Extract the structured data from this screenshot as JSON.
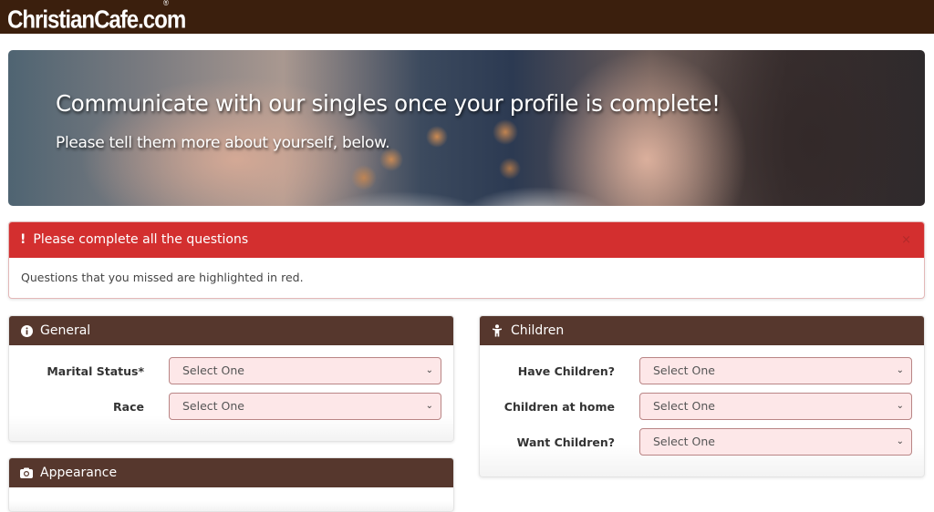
{
  "header": {
    "logo_text": "ChristianCafe.com",
    "registered_mark": "®",
    "bg_color": "#3b1f0d"
  },
  "hero": {
    "title": "Communicate with our singles once your profile is complete!",
    "subtitle": "Please tell them more about yourself, below."
  },
  "alert": {
    "icon": "exclamation-icon",
    "icon_glyph": "!",
    "title": "Please complete all the questions",
    "message": "Questions that you missed are highlighted in red.",
    "close_glyph": "×",
    "color": "#d32f2f"
  },
  "panels": {
    "general": {
      "title": "General",
      "icon": "info-circle-icon",
      "fields": [
        {
          "label": "Marital Status*",
          "value": "Select One"
        },
        {
          "label": "Race",
          "value": "Select One"
        }
      ]
    },
    "children": {
      "title": "Children",
      "icon": "child-icon",
      "fields": [
        {
          "label": "Have Children?",
          "value": "Select One"
        },
        {
          "label": "Children at home",
          "value": "Select One"
        },
        {
          "label": "Want Children?",
          "value": "Select One"
        }
      ]
    },
    "appearance": {
      "title": "Appearance",
      "icon": "camera-icon"
    }
  },
  "select_chevron": "⌄",
  "panel_header_color": "#56372d",
  "error_field_bg": "#fde7e8"
}
